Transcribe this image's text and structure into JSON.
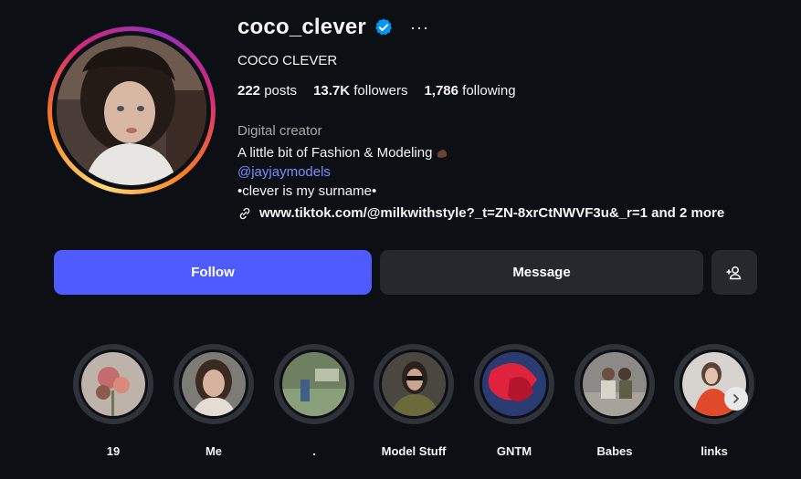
{
  "profile": {
    "username": "coco_clever",
    "full_name": "COCO CLEVER",
    "stats": {
      "posts_count": "222",
      "posts_label": "posts",
      "followers_count": "13.7K",
      "followers_label": "followers",
      "following_count": "1,786",
      "following_label": "following"
    },
    "category": "Digital creator",
    "bio_line1": "A little bit of Fashion & Modeling",
    "bio_mention": "@jayjaymodels",
    "bio_line3": "•clever is my surname•",
    "external_link": "www.tiktok.com/@milkwithstyle?_t=ZN-8xrCtNWVF3u&_r=1 and 2 more",
    "more_glyph": "···"
  },
  "buttons": {
    "follow": "Follow",
    "message": "Message"
  },
  "highlights": [
    {
      "label": "19"
    },
    {
      "label": "Me"
    },
    {
      "label": "."
    },
    {
      "label": "Model Stuff"
    },
    {
      "label": "GNTM"
    },
    {
      "label": "Babes"
    },
    {
      "label": "links"
    }
  ],
  "colors": {
    "background": "#0c0f14",
    "follow_button": "#4f5bff",
    "secondary_button": "#26282e",
    "link": "#7b8cff",
    "verified": "#0095f6"
  },
  "icons": {
    "verified": "verified-badge-icon",
    "more": "more-options-icon",
    "link": "link-icon",
    "add_user": "add-user-icon",
    "next": "chevron-right-icon"
  }
}
